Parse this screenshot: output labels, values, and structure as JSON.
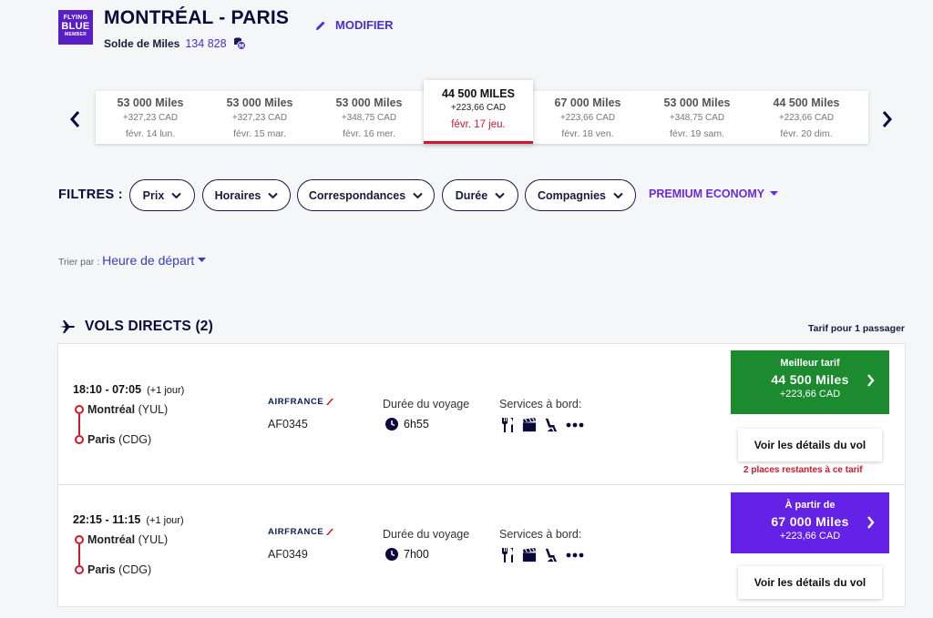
{
  "header": {
    "badge_line1": "FLYING",
    "badge_line2": "BLUE",
    "badge_line3": "MEMBER",
    "route": "MONTRÉAL - PARIS",
    "modify_label": "MODIFIER",
    "miles_balance_label": "Solde de Miles",
    "miles_balance_value": "134 828"
  },
  "dates": [
    {
      "miles": "53 000  Miles",
      "cad": "+327,23 CAD",
      "date": "févr. 14 lun.",
      "selected": false
    },
    {
      "miles": "53 000  Miles",
      "cad": "+327,23 CAD",
      "date": "févr. 15 mar.",
      "selected": false
    },
    {
      "miles": "53 000  Miles",
      "cad": "+348,75 CAD",
      "date": "févr. 16 mer.",
      "selected": false
    },
    {
      "miles": "44 500  MILES",
      "cad": "+223,66 CAD",
      "date": "févr. 17 jeu.",
      "selected": true
    },
    {
      "miles": "67 000  Miles",
      "cad": "+223,66 CAD",
      "date": "févr. 18 ven.",
      "selected": false
    },
    {
      "miles": "53 000  Miles",
      "cad": "+348,75 CAD",
      "date": "févr. 19 sam.",
      "selected": false
    },
    {
      "miles": "44 500  Miles",
      "cad": "+223,66 CAD",
      "date": "févr. 20 dim.",
      "selected": false
    }
  ],
  "filters": {
    "title": "FILTRES :",
    "items": [
      "Prix",
      "Horaires",
      "Correspondances",
      "Durée",
      "Compagnies"
    ],
    "cabin": "PREMIUM ECONOMY"
  },
  "sort": {
    "label": "Trier par :",
    "value": "Heure de départ"
  },
  "section": {
    "title": "VOLS DIRECTS (2)",
    "fare_note": "Tarif pour 1 passager"
  },
  "flights": [
    {
      "times": "18:10 - 07:05",
      "plus_day": "(+1 jour)",
      "origin_city": "Montréal",
      "origin_code": "(YUL)",
      "dest_city": "Paris",
      "dest_code": "(CDG)",
      "airline": "AIRFRANCE",
      "flight_number": "AF0345",
      "duration_label": "Durée du voyage",
      "duration": "6h55",
      "services_label": "Services à bord:",
      "fare_title": "Meilleur tarif",
      "fare_miles": "44 500  Miles",
      "fare_cad": "+223,66 CAD",
      "fare_color": "#1c8a2e",
      "details_label": "Voir les détails du vol",
      "remaining": "2 places restantes à ce tarif"
    },
    {
      "times": "22:15 - 11:15",
      "plus_day": "(+1 jour)",
      "origin_city": "Montréal",
      "origin_code": "(YUL)",
      "dest_city": "Paris",
      "dest_code": "(CDG)",
      "airline": "AIRFRANCE",
      "flight_number": "AF0349",
      "duration_label": "Durée du voyage",
      "duration": "7h00",
      "services_label": "Services à bord:",
      "fare_title": "À partir de",
      "fare_miles": "67 000  Miles",
      "fare_cad": "+223,66 CAD",
      "fare_color": "#6422e6",
      "details_label": "Voir les détails du vol"
    }
  ],
  "icons": [
    "pencil-icon",
    "coin-stack-icon",
    "chevron-left-icon",
    "chevron-right-icon",
    "chevron-down-icon",
    "plane-icon",
    "clock-icon",
    "meal-icon",
    "movie-icon",
    "seat-icon",
    "more-icon"
  ]
}
